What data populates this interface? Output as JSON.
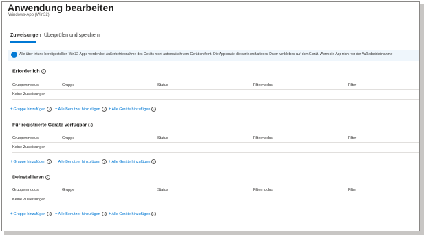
{
  "header": {
    "title": "Anwendung bearbeiten",
    "more_label": "···",
    "subtitle": "Windows-App (Win32)"
  },
  "tabs": [
    {
      "label": "Zuweisungen",
      "active": true
    },
    {
      "label": "Überprüfen und speichern",
      "active": false
    }
  ],
  "info_banner": {
    "icon": "info-icon",
    "text": "Alle über Intune bereitgestellten Win32-Apps werden bei Außerbetriebnahme des Geräts nicht automatisch vom Gerät entfernt. Die App sowie die darin enthaltenen Daten verbleiben auf dem Gerät. Wenn die App nicht vor der Außerbetriebnahme"
  },
  "columns": [
    "Gruppenmodus",
    "Gruppe",
    "Status",
    "Filtermodus",
    "Filter"
  ],
  "sections": [
    {
      "title": "Erforderlich",
      "empty_text": "Keine Zuweisungen",
      "links": [
        "Gruppe hinzufügen",
        "Alle Benutzer hinzufügen",
        "Alle Geräte hinzufügen"
      ]
    },
    {
      "title": "Für registrierte Geräte verfügbar",
      "empty_text": "Keine Zuweisungen",
      "links": [
        "Gruppe hinzufügen",
        "Alle Benutzer hinzufügen",
        "Alle Geräte hinzufügen"
      ]
    },
    {
      "title": "Deinstallieren",
      "empty_text": "Keine Zuweisungen",
      "links": [
        "Gruppe hinzufügen",
        "Alle Benutzer hinzufügen",
        "Alle Geräte hinzufügen"
      ]
    }
  ],
  "colors": {
    "accent": "#0078d4",
    "info_bg": "#eff6fc"
  }
}
